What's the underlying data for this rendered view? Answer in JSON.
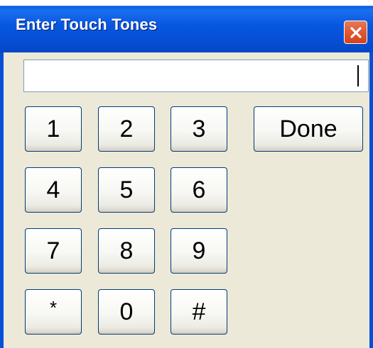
{
  "window": {
    "title": "Enter Touch Tones",
    "close_icon": "close-icon"
  },
  "entry": {
    "value": "",
    "placeholder": ""
  },
  "keypad": {
    "keys": [
      "1",
      "2",
      "3",
      "4",
      "5",
      "6",
      "7",
      "8",
      "9",
      "*",
      "0",
      "#"
    ]
  },
  "actions": {
    "done_label": "Done"
  },
  "colors": {
    "titlebar": "#0650d6",
    "client_bg": "#ece9d8",
    "close_button": "#e25b34",
    "button_border": "#003c74"
  }
}
